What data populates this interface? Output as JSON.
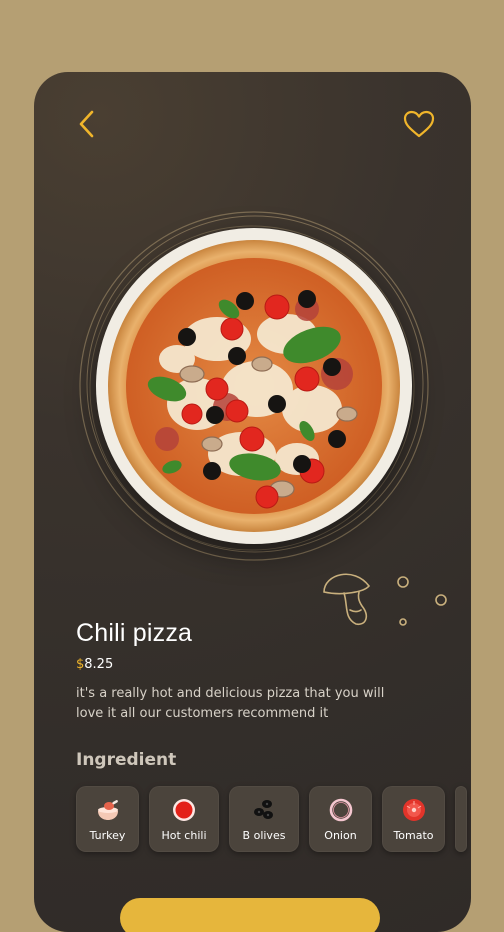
{
  "header": {
    "back_icon": "chevron-left-icon",
    "favorite_icon": "heart-icon",
    "accent_color": "#f0b52b"
  },
  "product": {
    "name": "Chili pizza",
    "currency": "$",
    "price": "8.25",
    "description": "it's a really hot and delicious pizza that you will love it all our customers recommend it"
  },
  "ingredients": {
    "title": "Ingredient",
    "items": [
      {
        "label": "Turkey",
        "icon": "turkey-icon"
      },
      {
        "label": "Hot chili",
        "icon": "hot-chili-icon"
      },
      {
        "label": "B olives",
        "icon": "black-olives-icon"
      },
      {
        "label": "Onion",
        "icon": "onion-icon"
      },
      {
        "label": "Tomato",
        "icon": "tomato-icon"
      }
    ]
  },
  "colors": {
    "background": "#b59f73",
    "card": "#332e2a",
    "chip": "#4b443c",
    "accent": "#f0b52b"
  }
}
